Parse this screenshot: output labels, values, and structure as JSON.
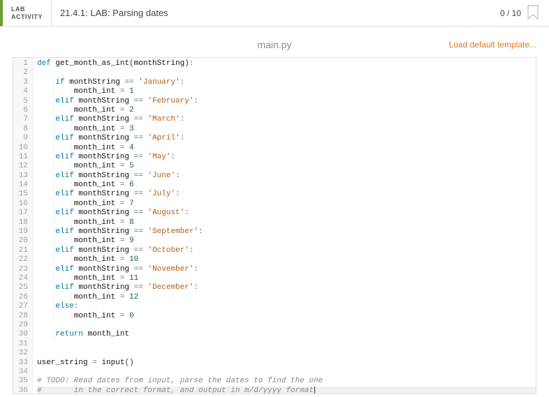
{
  "header": {
    "badge_line1": "LAB",
    "badge_line2": "ACTIVITY",
    "title": "21.4.1: LAB: Parsing dates",
    "score": "0 / 10"
  },
  "file": {
    "name": "main.py",
    "load_template": "Load default template..."
  },
  "code": {
    "total_lines": 36,
    "current_line": 36,
    "lines": [
      {
        "n": 1,
        "segs": [
          [
            "kw",
            "def"
          ],
          [
            "sp",
            " "
          ],
          [
            "fn",
            "get_month_as_int"
          ],
          [
            "paren",
            "("
          ],
          [
            "ident",
            "monthString"
          ],
          [
            "paren",
            ")"
          ],
          [
            "op",
            ":"
          ]
        ]
      },
      {
        "n": 2,
        "segs": []
      },
      {
        "n": 3,
        "segs": [
          [
            "sp",
            "    "
          ],
          [
            "kw",
            "if"
          ],
          [
            "sp",
            " "
          ],
          [
            "ident",
            "monthString"
          ],
          [
            "sp",
            " "
          ],
          [
            "op",
            "=="
          ],
          [
            "sp",
            " "
          ],
          [
            "str",
            "'January'"
          ],
          [
            "op",
            ":"
          ]
        ]
      },
      {
        "n": 4,
        "segs": [
          [
            "sp",
            "        "
          ],
          [
            "ident",
            "month_int"
          ],
          [
            "sp",
            " "
          ],
          [
            "op",
            "="
          ],
          [
            "sp",
            " "
          ],
          [
            "num",
            "1"
          ]
        ]
      },
      {
        "n": 5,
        "segs": [
          [
            "sp",
            "    "
          ],
          [
            "kw",
            "elif"
          ],
          [
            "sp",
            " "
          ],
          [
            "ident",
            "monthString"
          ],
          [
            "sp",
            " "
          ],
          [
            "op",
            "=="
          ],
          [
            "sp",
            " "
          ],
          [
            "str",
            "'February'"
          ],
          [
            "op",
            ":"
          ]
        ]
      },
      {
        "n": 6,
        "segs": [
          [
            "sp",
            "        "
          ],
          [
            "ident",
            "month_int"
          ],
          [
            "sp",
            " "
          ],
          [
            "op",
            "="
          ],
          [
            "sp",
            " "
          ],
          [
            "num",
            "2"
          ]
        ]
      },
      {
        "n": 7,
        "segs": [
          [
            "sp",
            "    "
          ],
          [
            "kw",
            "elif"
          ],
          [
            "sp",
            " "
          ],
          [
            "ident",
            "monthString"
          ],
          [
            "sp",
            " "
          ],
          [
            "op",
            "=="
          ],
          [
            "sp",
            " "
          ],
          [
            "str",
            "'March'"
          ],
          [
            "op",
            ":"
          ]
        ]
      },
      {
        "n": 8,
        "segs": [
          [
            "sp",
            "        "
          ],
          [
            "ident",
            "month_int"
          ],
          [
            "sp",
            " "
          ],
          [
            "op",
            "="
          ],
          [
            "sp",
            " "
          ],
          [
            "num",
            "3"
          ]
        ]
      },
      {
        "n": 9,
        "segs": [
          [
            "sp",
            "    "
          ],
          [
            "kw",
            "elif"
          ],
          [
            "sp",
            " "
          ],
          [
            "ident",
            "monthString"
          ],
          [
            "sp",
            " "
          ],
          [
            "op",
            "=="
          ],
          [
            "sp",
            " "
          ],
          [
            "str",
            "'April'"
          ],
          [
            "op",
            ":"
          ]
        ]
      },
      {
        "n": 10,
        "segs": [
          [
            "sp",
            "        "
          ],
          [
            "ident",
            "month_int"
          ],
          [
            "sp",
            " "
          ],
          [
            "op",
            "="
          ],
          [
            "sp",
            " "
          ],
          [
            "num",
            "4"
          ]
        ]
      },
      {
        "n": 11,
        "segs": [
          [
            "sp",
            "    "
          ],
          [
            "kw",
            "elif"
          ],
          [
            "sp",
            " "
          ],
          [
            "ident",
            "monthString"
          ],
          [
            "sp",
            " "
          ],
          [
            "op",
            "=="
          ],
          [
            "sp",
            " "
          ],
          [
            "str",
            "'May'"
          ],
          [
            "op",
            ":"
          ]
        ]
      },
      {
        "n": 12,
        "segs": [
          [
            "sp",
            "        "
          ],
          [
            "ident",
            "month_int"
          ],
          [
            "sp",
            " "
          ],
          [
            "op",
            "="
          ],
          [
            "sp",
            " "
          ],
          [
            "num",
            "5"
          ]
        ]
      },
      {
        "n": 13,
        "segs": [
          [
            "sp",
            "    "
          ],
          [
            "kw",
            "elif"
          ],
          [
            "sp",
            " "
          ],
          [
            "ident",
            "monthString"
          ],
          [
            "sp",
            " "
          ],
          [
            "op",
            "=="
          ],
          [
            "sp",
            " "
          ],
          [
            "str",
            "'June'"
          ],
          [
            "op",
            ":"
          ]
        ]
      },
      {
        "n": 14,
        "segs": [
          [
            "sp",
            "        "
          ],
          [
            "ident",
            "month_int"
          ],
          [
            "sp",
            " "
          ],
          [
            "op",
            "="
          ],
          [
            "sp",
            " "
          ],
          [
            "num",
            "6"
          ]
        ]
      },
      {
        "n": 15,
        "segs": [
          [
            "sp",
            "    "
          ],
          [
            "kw",
            "elif"
          ],
          [
            "sp",
            " "
          ],
          [
            "ident",
            "monthString"
          ],
          [
            "sp",
            " "
          ],
          [
            "op",
            "=="
          ],
          [
            "sp",
            " "
          ],
          [
            "str",
            "'July'"
          ],
          [
            "op",
            ":"
          ]
        ]
      },
      {
        "n": 16,
        "segs": [
          [
            "sp",
            "        "
          ],
          [
            "ident",
            "month_int"
          ],
          [
            "sp",
            " "
          ],
          [
            "op",
            "="
          ],
          [
            "sp",
            " "
          ],
          [
            "num",
            "7"
          ]
        ]
      },
      {
        "n": 17,
        "segs": [
          [
            "sp",
            "    "
          ],
          [
            "kw",
            "elif"
          ],
          [
            "sp",
            " "
          ],
          [
            "ident",
            "monthString"
          ],
          [
            "sp",
            " "
          ],
          [
            "op",
            "=="
          ],
          [
            "sp",
            " "
          ],
          [
            "str",
            "'August'"
          ],
          [
            "op",
            ":"
          ]
        ]
      },
      {
        "n": 18,
        "segs": [
          [
            "sp",
            "        "
          ],
          [
            "ident",
            "month_int"
          ],
          [
            "sp",
            " "
          ],
          [
            "op",
            "="
          ],
          [
            "sp",
            " "
          ],
          [
            "num",
            "8"
          ]
        ]
      },
      {
        "n": 19,
        "segs": [
          [
            "sp",
            "    "
          ],
          [
            "kw",
            "elif"
          ],
          [
            "sp",
            " "
          ],
          [
            "ident",
            "monthString"
          ],
          [
            "sp",
            " "
          ],
          [
            "op",
            "=="
          ],
          [
            "sp",
            " "
          ],
          [
            "str",
            "'September'"
          ],
          [
            "op",
            ":"
          ]
        ]
      },
      {
        "n": 20,
        "segs": [
          [
            "sp",
            "        "
          ],
          [
            "ident",
            "month_int"
          ],
          [
            "sp",
            " "
          ],
          [
            "op",
            "="
          ],
          [
            "sp",
            " "
          ],
          [
            "num",
            "9"
          ]
        ]
      },
      {
        "n": 21,
        "segs": [
          [
            "sp",
            "    "
          ],
          [
            "kw",
            "elif"
          ],
          [
            "sp",
            " "
          ],
          [
            "ident",
            "monthString"
          ],
          [
            "sp",
            " "
          ],
          [
            "op",
            "=="
          ],
          [
            "sp",
            " "
          ],
          [
            "str",
            "'October'"
          ],
          [
            "op",
            ":"
          ]
        ]
      },
      {
        "n": 22,
        "segs": [
          [
            "sp",
            "        "
          ],
          [
            "ident",
            "month_int"
          ],
          [
            "sp",
            " "
          ],
          [
            "op",
            "="
          ],
          [
            "sp",
            " "
          ],
          [
            "num",
            "10"
          ]
        ]
      },
      {
        "n": 23,
        "segs": [
          [
            "sp",
            "    "
          ],
          [
            "kw",
            "elif"
          ],
          [
            "sp",
            " "
          ],
          [
            "ident",
            "monthString"
          ],
          [
            "sp",
            " "
          ],
          [
            "op",
            "=="
          ],
          [
            "sp",
            " "
          ],
          [
            "str",
            "'November'"
          ],
          [
            "op",
            ":"
          ]
        ]
      },
      {
        "n": 24,
        "segs": [
          [
            "sp",
            "        "
          ],
          [
            "ident",
            "month_int"
          ],
          [
            "sp",
            " "
          ],
          [
            "op",
            "="
          ],
          [
            "sp",
            " "
          ],
          [
            "num",
            "11"
          ]
        ]
      },
      {
        "n": 25,
        "segs": [
          [
            "sp",
            "    "
          ],
          [
            "kw",
            "elif"
          ],
          [
            "sp",
            " "
          ],
          [
            "ident",
            "monthString"
          ],
          [
            "sp",
            " "
          ],
          [
            "op",
            "=="
          ],
          [
            "sp",
            " "
          ],
          [
            "str",
            "'December'"
          ],
          [
            "op",
            ":"
          ]
        ]
      },
      {
        "n": 26,
        "segs": [
          [
            "sp",
            "        "
          ],
          [
            "ident",
            "month_int"
          ],
          [
            "sp",
            " "
          ],
          [
            "op",
            "="
          ],
          [
            "sp",
            " "
          ],
          [
            "num",
            "12"
          ]
        ]
      },
      {
        "n": 27,
        "segs": [
          [
            "sp",
            "    "
          ],
          [
            "kw",
            "else"
          ],
          [
            "op",
            ":"
          ]
        ]
      },
      {
        "n": 28,
        "segs": [
          [
            "sp",
            "        "
          ],
          [
            "ident",
            "month_int"
          ],
          [
            "sp",
            " "
          ],
          [
            "op",
            "="
          ],
          [
            "sp",
            " "
          ],
          [
            "num",
            "0"
          ]
        ]
      },
      {
        "n": 29,
        "segs": []
      },
      {
        "n": 30,
        "segs": [
          [
            "sp",
            "    "
          ],
          [
            "kw",
            "return"
          ],
          [
            "sp",
            " "
          ],
          [
            "ident",
            "month_int"
          ]
        ]
      },
      {
        "n": 31,
        "segs": []
      },
      {
        "n": 32,
        "segs": []
      },
      {
        "n": 33,
        "segs": [
          [
            "ident",
            "user_string"
          ],
          [
            "sp",
            " "
          ],
          [
            "op",
            "="
          ],
          [
            "sp",
            " "
          ],
          [
            "fn",
            "input"
          ],
          [
            "paren",
            "()"
          ]
        ]
      },
      {
        "n": 34,
        "segs": []
      },
      {
        "n": 35,
        "segs": [
          [
            "comment",
            "# TODO: Read dates from input, parse the dates to find the one"
          ]
        ]
      },
      {
        "n": 36,
        "segs": [
          [
            "comment",
            "#       in the correct format, and output in m/d/yyyy format"
          ]
        ],
        "cursor": true
      }
    ]
  }
}
